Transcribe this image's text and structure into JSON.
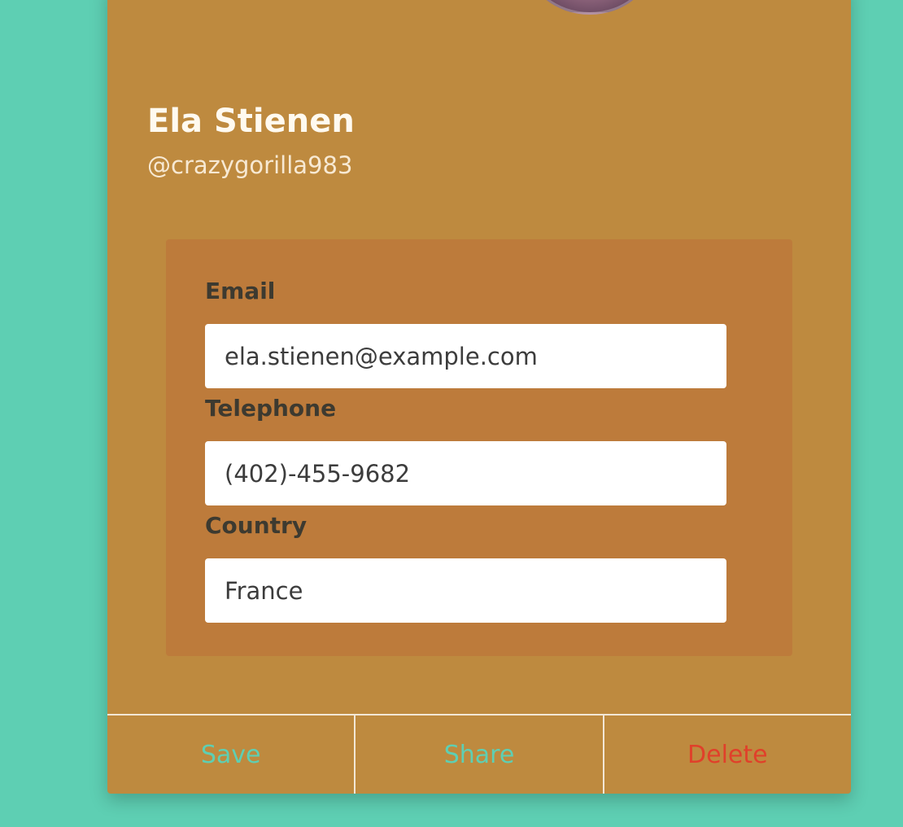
{
  "profile": {
    "name": "Ela Stienen",
    "handle": "@crazygorilla983"
  },
  "details": {
    "email_label": "Email",
    "email_value": "ela.stienen@example.com",
    "telephone_label": "Telephone",
    "telephone_value": "(402)-455-9682",
    "country_label": "Country",
    "country_value": "France"
  },
  "actions": {
    "save_label": "Save",
    "share_label": "Share",
    "delete_label": "Delete"
  },
  "colors": {
    "background": "#5ecfb3",
    "card": "#be8a3f",
    "details_panel": "#bd7b3b",
    "action_text": "#5ecfb3",
    "delete_text": "#e0402a"
  }
}
